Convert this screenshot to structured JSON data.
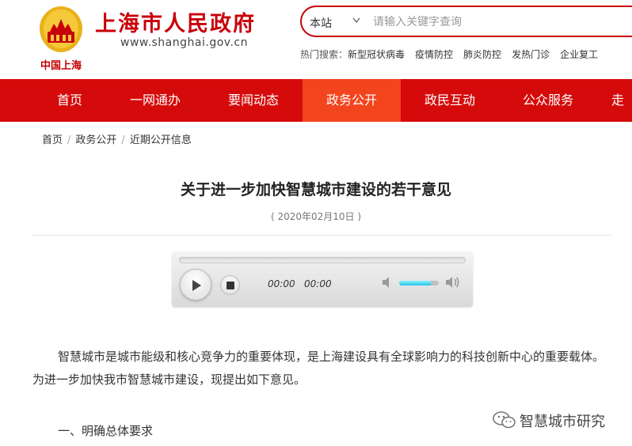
{
  "header": {
    "emblem_caption": "中国上海",
    "site_title": "上海市人民政府",
    "site_url": "www.shanghai.gov.cn"
  },
  "search": {
    "scope": "本站",
    "placeholder": "请输入关键字查询"
  },
  "hot_search": {
    "label": "热门搜索：",
    "items": [
      "新型冠状病毒",
      "疫情防控",
      "肺炎防控",
      "发热门诊",
      "企业复工"
    ]
  },
  "nav": {
    "items": [
      "首页",
      "一网通办",
      "要闻动态",
      "政务公开",
      "政民互动",
      "公众服务",
      "走"
    ],
    "active": "政务公开"
  },
  "breadcrumb": [
    "首页",
    "政务公开",
    "近期公开信息"
  ],
  "article": {
    "title": "关于进一步加快智慧城市建设的若干意见",
    "date": "( 2020年02月10日 )",
    "paragraph": "智慧城市是城市能级和核心竞争力的重要体现，是上海建设具有全球影响力的科技创新中心的重要载体。为进一步加快我市智慧城市建设，现提出如下意见。",
    "section_heading": "一、明确总体要求"
  },
  "player": {
    "current_time": "00:00",
    "duration": "00:00",
    "volume": 0.8
  },
  "watermark": "智慧城市研究",
  "colors": {
    "brand_red": "#d50b0b",
    "nav_active": "#f2441d",
    "title_red": "#c8000a"
  }
}
